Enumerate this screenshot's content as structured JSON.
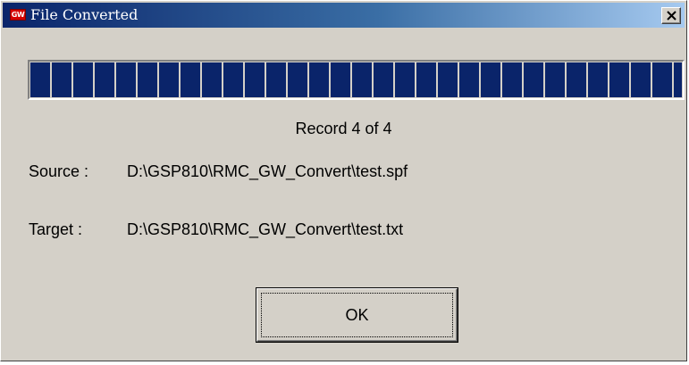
{
  "window": {
    "title": "File Converted",
    "app_icon_label": "GW",
    "app_icon_name": "gw-app-icon",
    "close_icon_name": "close-icon"
  },
  "progress": {
    "fraction": 1.0,
    "fill_color": "#0a246a"
  },
  "record_status": "Record 4 of 4",
  "source": {
    "label": "Source :",
    "path": "D:\\GSP810\\RMC_GW_Convert\\test.spf"
  },
  "target": {
    "label": "Target :",
    "path": "D:\\GSP810\\RMC_GW_Convert\\test.txt"
  },
  "buttons": {
    "ok_label": "OK"
  }
}
